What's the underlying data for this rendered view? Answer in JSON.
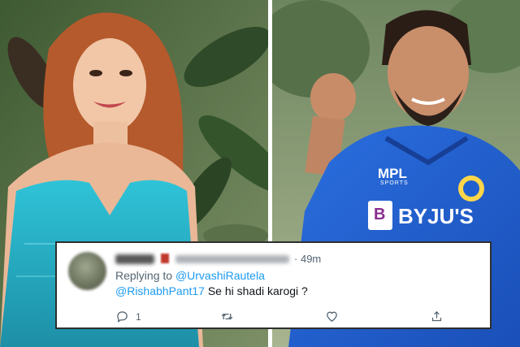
{
  "tweet": {
    "time_sep": "·",
    "time": "49m",
    "replying_prefix": "Replying to ",
    "replying_handle": "@UrvashiRautela",
    "mention": "@RishabhPant17",
    "text": " Se hi shadi karogi ?",
    "reply_count": "1",
    "reply_icon": "comment-icon",
    "retweet_icon": "retweet-icon",
    "like_icon": "heart-icon",
    "share_icon": "share-icon"
  },
  "right_photo": {
    "jersey_brand_1": "MPL",
    "jersey_brand_1_sub": "SPORTS",
    "jersey_brand_2": "BYJU'S",
    "jersey_logo_letter": "B"
  },
  "colors": {
    "mention_blue": "#1d9bf0",
    "muted_text": "#536471",
    "jersey_blue": "#1f5fd0",
    "dress_teal": "#27b3c9"
  }
}
